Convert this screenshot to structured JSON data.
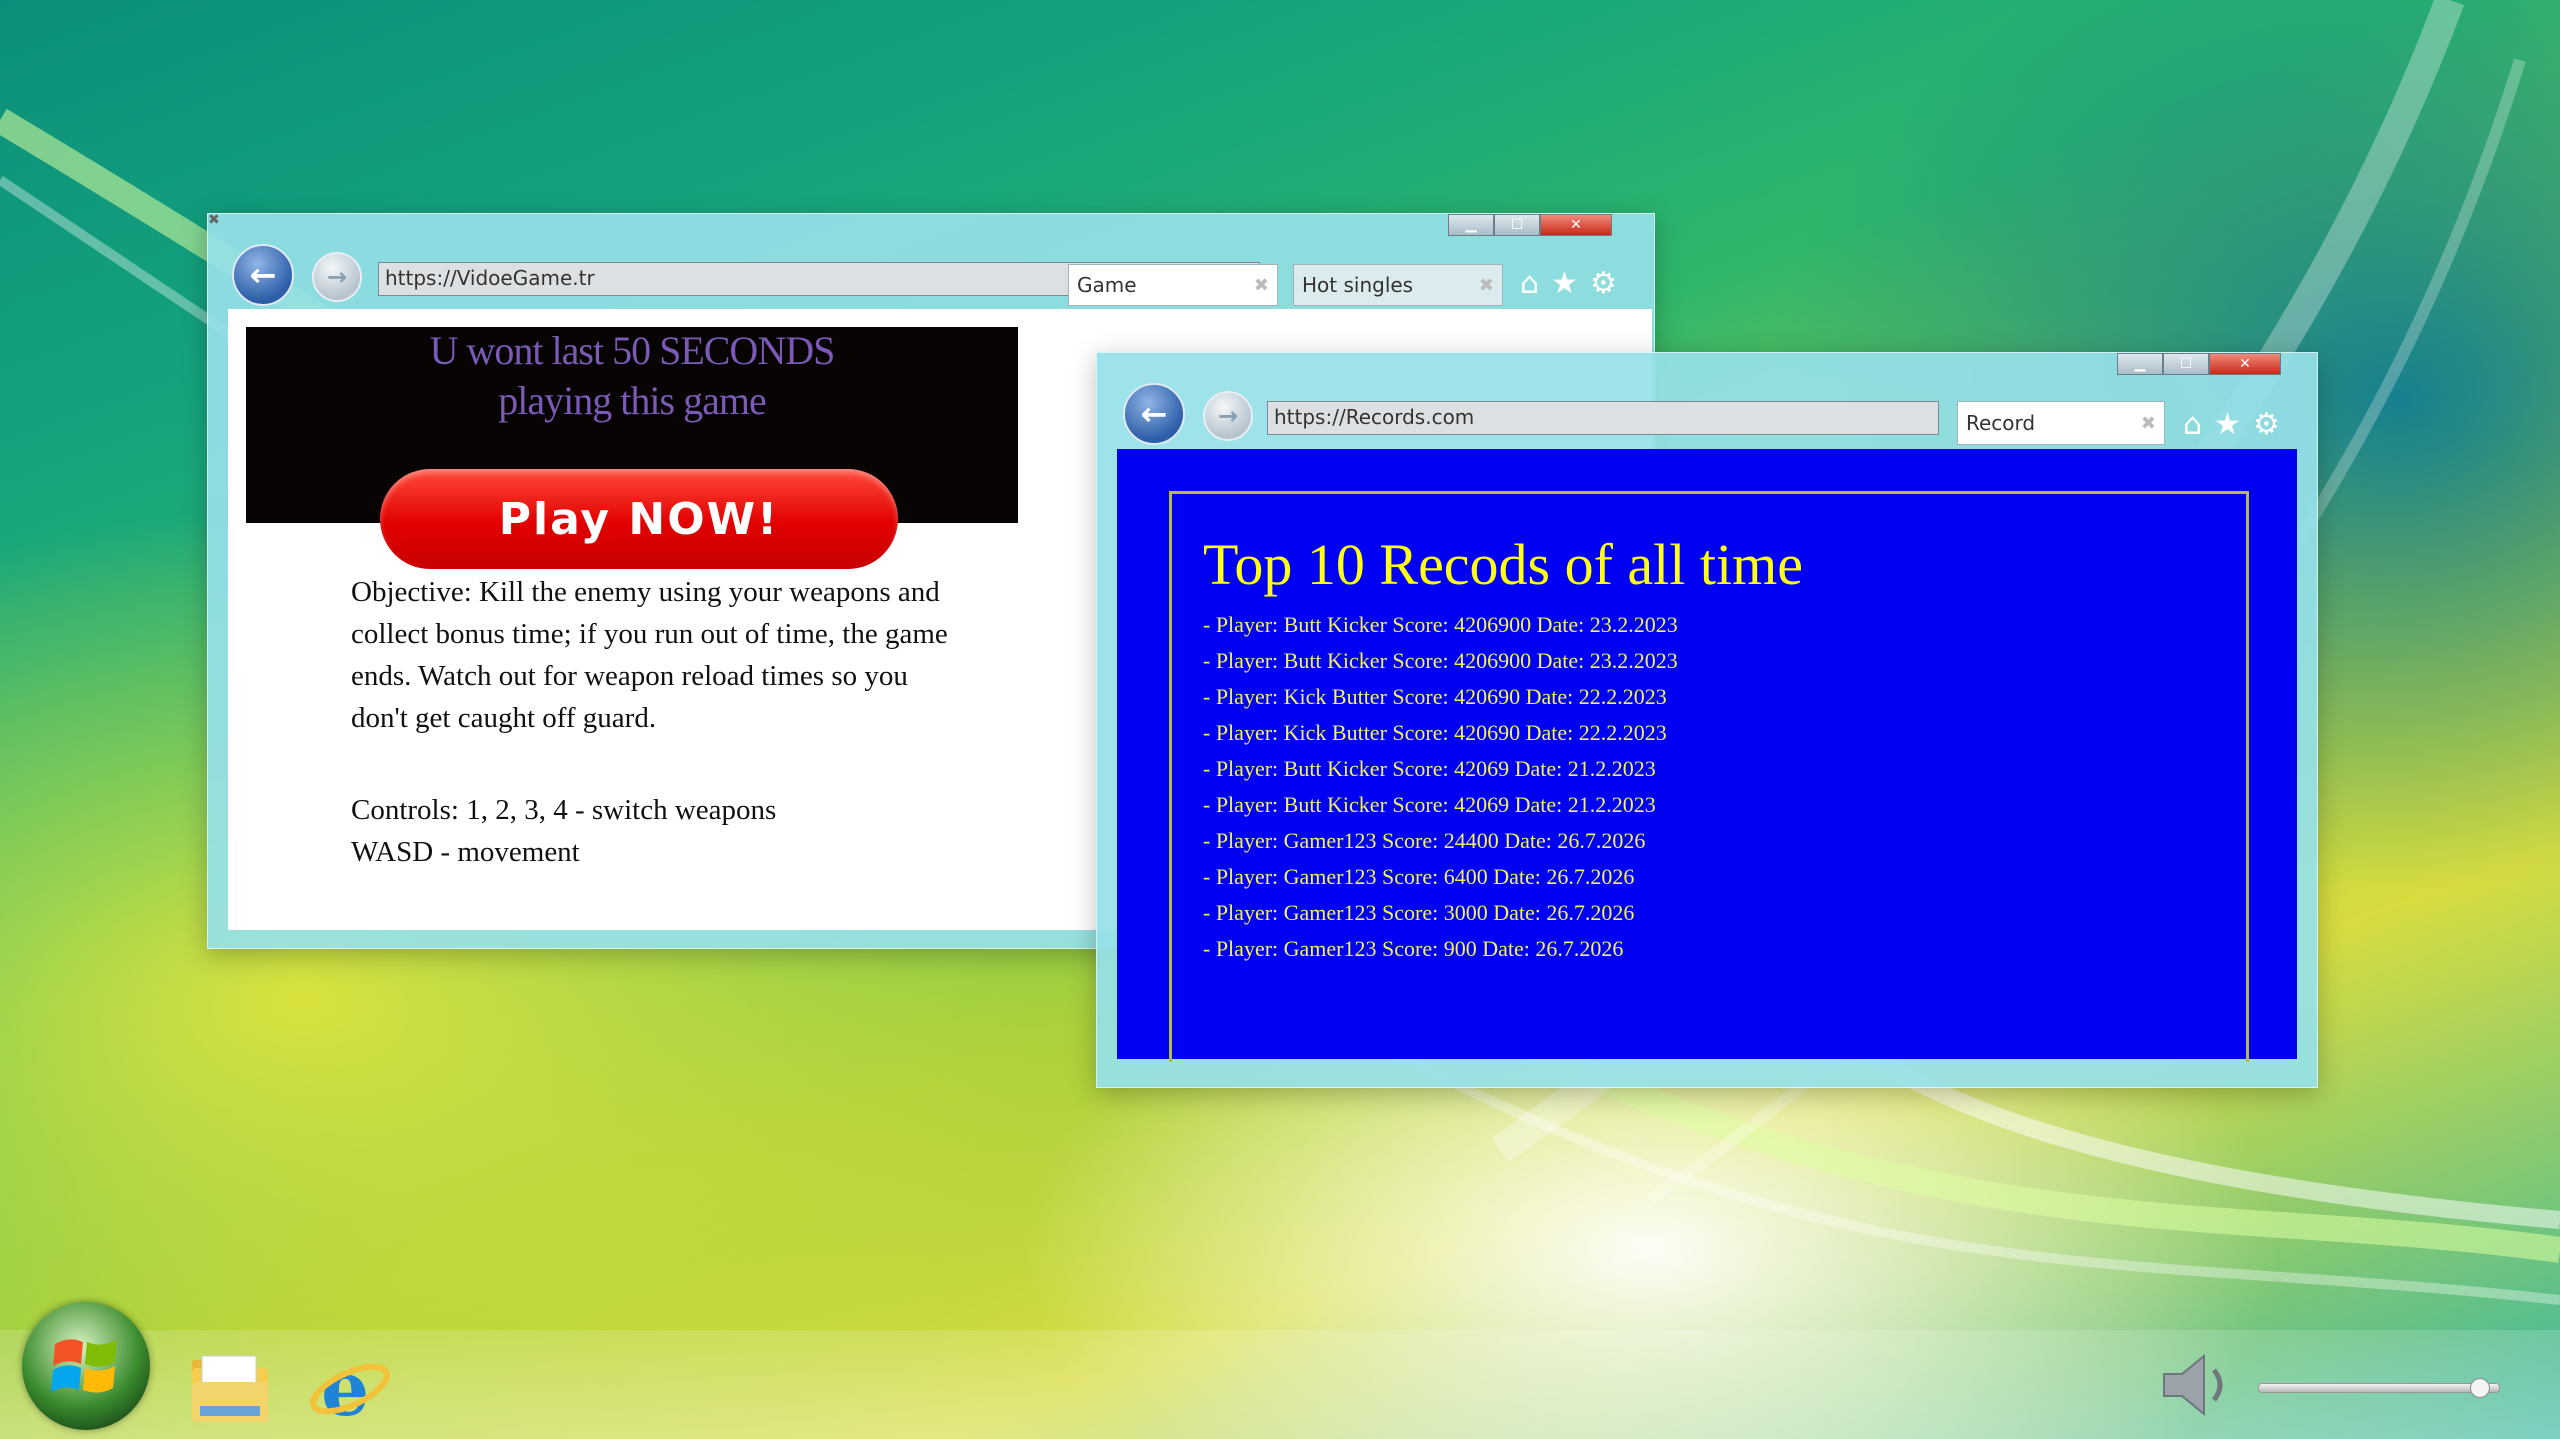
{
  "windows": {
    "game": {
      "url": "https://VidoeGame.tr",
      "tabs": [
        {
          "label": "Game"
        },
        {
          "label": "Hot singles"
        }
      ],
      "banner": {
        "line1": "U wont last 50 SECONDS",
        "line2": "playing this game",
        "button": "Play NOW!"
      },
      "paragraphs": [
        "Objective: Kill the enemy using your weapons and collect bonus time; if you run out of time, the game ends. Watch out for weapon reload times so you don't get caught off guard.",
        "Controls: 1, 2, 3, 4 - switch weapons",
        "WASD - movement"
      ]
    },
    "records": {
      "url": "https://Records.com",
      "tabs": [
        {
          "label": "Record"
        }
      ],
      "title": "Top 10 Recods of all time",
      "records": [
        "- Player: Butt Kicker Score: 4206900 Date: 23.2.2023",
        "- Player: Butt Kicker Score: 4206900 Date: 23.2.2023",
        "- Player: Kick Butter Score: 420690 Date: 22.2.2023",
        "- Player: Kick Butter Score: 420690 Date: 22.2.2023",
        "- Player: Butt Kicker Score: 42069 Date: 21.2.2023",
        "- Player: Butt Kicker Score: 42069 Date: 21.2.2023",
        "- Player: Gamer123 Score: 24400 Date: 26.7.2026",
        "- Player: Gamer123 Score: 6400 Date: 26.7.2026",
        "- Player: Gamer123 Score: 3000 Date: 26.7.2026",
        "- Player: Gamer123 Score: 900 Date: 26.7.2026"
      ]
    }
  },
  "taskbar": {
    "pinned": [
      "file-explorer-icon",
      "internet-explorer-icon"
    ],
    "volume_level": 0.95
  },
  "colors": {
    "records_bg": "#0000f2",
    "records_title": "#ffff14",
    "play_button": "#e10000",
    "window_frame": "#96e1e8"
  }
}
